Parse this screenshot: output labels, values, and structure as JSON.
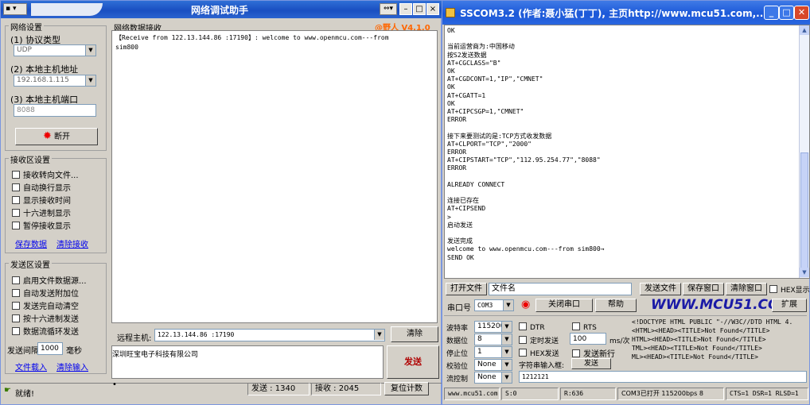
{
  "left": {
    "title": "网络调试助手",
    "brand": "@野人 V4.1.0",
    "settings": {
      "group_title": "网络设置",
      "protocol_label": "(1) 协议类型",
      "protocol_value": "UDP",
      "local_ip_label": "(2) 本地主机地址",
      "local_ip_value": "192.168.1.115",
      "local_port_label": "(3) 本地主机端口",
      "local_port_value": "8088",
      "disconnect_label": "断开"
    },
    "recv_settings": {
      "group_title": "接收区设置",
      "options": [
        "接收转向文件...",
        "自动换行显示",
        "显示接收时间",
        "十六进制显示",
        "暂停接收显示"
      ],
      "save_link": "保存数据",
      "clear_link": "清除接收"
    },
    "send_settings": {
      "group_title": "发送区设置",
      "options": [
        "启用文件数据源...",
        "自动发送附加位",
        "发送完自动清空",
        "按十六进制发送",
        "数据流循环发送"
      ],
      "interval_label": "发送间隔",
      "interval_value": "1000",
      "interval_unit": "毫秒",
      "load_link": "文件载入",
      "clear_link": "清除输入"
    },
    "recv_area": {
      "title": "网络数据接收",
      "line1": "【Receive from 122.13.144.86 :17190】: welcome to www.openmcu.com---from",
      "line2": "sim800"
    },
    "remote_label": "远程主机:",
    "remote_value": "122.13.144.86 :17190",
    "clear_button": "清除",
    "send_text": "深圳旺宝电子科技有限公司",
    "send_button": "发送",
    "status": {
      "ready": "就绪!",
      "sent": "发送 : 1340",
      "received": "接收 : 2045",
      "reset": "复位计数"
    }
  },
  "right": {
    "title": "SSCOM3.2 (作者:聂小猛(丁丁), 主页http://www.mcu51.com,...",
    "output_lines": [
      "OK",
      "",
      "当前运营商为:中国移动",
      "按S2发送数据",
      "AT+CGCLASS=\"B\"",
      "OK",
      "AT+CGDCONT=1,\"IP\",\"CMNET\"",
      "OK",
      "AT+CGATT=1",
      "OK",
      "AT+CIPCSGP=1,\"CMNET\"",
      "ERROR",
      "",
      "接下来要测试的是:TCP方式收发数据",
      "AT+CLPORT=\"TCP\",\"2000\"",
      "ERROR",
      "AT+CIPSTART=\"TCP\",\"112.95.254.77\",\"8088\"",
      "ERROR",
      "",
      "ALREADY CONNECT",
      "",
      "连接已存在",
      "AT+CIPSEND",
      ">",
      "启动发送",
      "",
      "发送完成",
      "welcome to www.openmcu.com---from sim800→",
      "SEND OK"
    ],
    "open_file": "打开文件",
    "file_name": "文件名",
    "send_file": "发送文件",
    "save_window": "保存窗口",
    "clear_window": "清除窗口",
    "hex_display": "HEX显示",
    "port_label": "串口号",
    "port_value": "COM3",
    "close_port": "关闭串口",
    "help": "帮助",
    "website": "WWW.MCU51.COM",
    "expand": "扩展",
    "baud_label": "波特率",
    "baud_value": "115200",
    "databits_label": "数据位",
    "databits_value": "8",
    "stopbits_label": "停止位",
    "stopbits_value": "1",
    "parity_label": "校验位",
    "parity_value": "None",
    "flow_label": "流控制",
    "flow_value": "None",
    "dtr": "DTR",
    "rts": "RTS",
    "timed_send": "定时发送",
    "interval_value": "100",
    "interval_unit": "ms/次",
    "hex_send": "HEX发送",
    "send_newline": "发送新行",
    "char_input": "字符串输入框:",
    "send_btn": "发送",
    "input_value": "1212121",
    "html_lines": [
      "<!DOCTYPE HTML PUBLIC \"-//W3C//DTD HTML 4.",
      "<HTML><HEAD><TITLE>Not Found</TITLE>",
      "HTML><HEAD><TITLE>Not Found</TITLE>",
      "TML><HEAD><TITLE>Not Found</TITLE>",
      "ML><HEAD><TITLE>Not Found</TITLE>"
    ],
    "status": {
      "site": "www.mcu51.com",
      "s": "S:0",
      "r": "R:636",
      "port": "COM3已打开  115200bps  8",
      "lines": "CTS=1 DSR=1 RLSD=1"
    }
  }
}
